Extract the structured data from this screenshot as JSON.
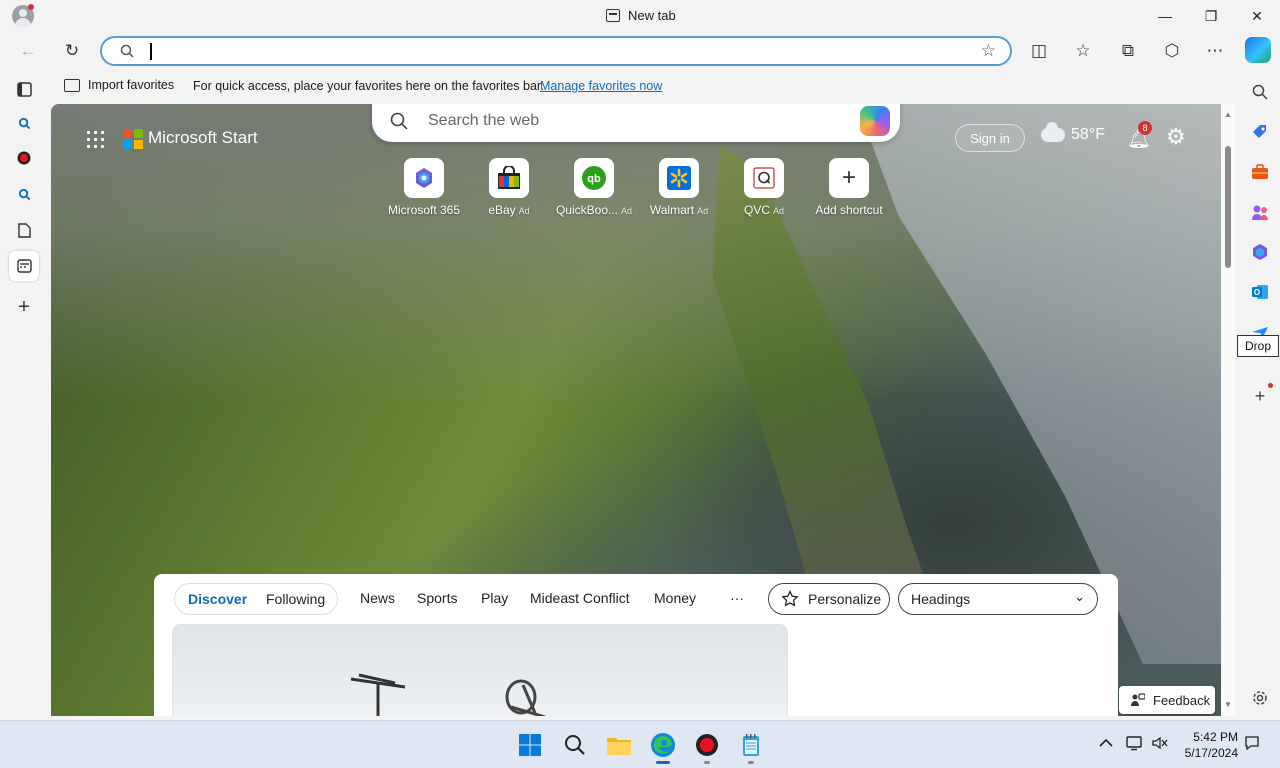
{
  "window": {
    "tab_title": "New tab",
    "minimize": "—",
    "restore": "❐",
    "close": "✕"
  },
  "toolbar": {
    "back": "←",
    "refresh": "↻",
    "address_value": "",
    "favorite_star": "☆",
    "split_screen": "◫",
    "favorites": "☆",
    "collections": "⧉",
    "extensions": "⬡",
    "more": "⋯"
  },
  "favorites_bar": {
    "import_label": "Import favorites",
    "message": "For quick access, place your favorites here on the favorites bar.",
    "manage_link": "Manage favorites now"
  },
  "newtab": {
    "brand": "Microsoft Start",
    "search_placeholder": "Search the web",
    "sign_in": "Sign in",
    "temperature": "58°F",
    "notification_count": "8",
    "settings": "⚙",
    "shortcuts": [
      {
        "label": "Microsoft 365",
        "ad": ""
      },
      {
        "label": "eBay",
        "ad": "Ad"
      },
      {
        "label": "QuickBoo...",
        "ad": "Ad"
      },
      {
        "label": "Walmart",
        "ad": "Ad"
      },
      {
        "label": "QVC",
        "ad": "Ad"
      },
      {
        "label": "Add shortcut",
        "ad": ""
      }
    ]
  },
  "feed": {
    "discover": "Discover",
    "following": "Following",
    "nav": [
      "News",
      "Sports",
      "Play",
      "Mideast Conflict",
      "Money",
      "···"
    ],
    "personalize": "Personalize",
    "headings": "Headings"
  },
  "feedback": "Feedback",
  "right_sidebar": {
    "tooltip": "Drop"
  },
  "taskbar": {
    "time": "5:42 PM",
    "date": "5/17/2024"
  },
  "colors": {
    "accent": "#0f6cbd",
    "address_border": "#5b9bd5",
    "badge": "#d13438"
  }
}
